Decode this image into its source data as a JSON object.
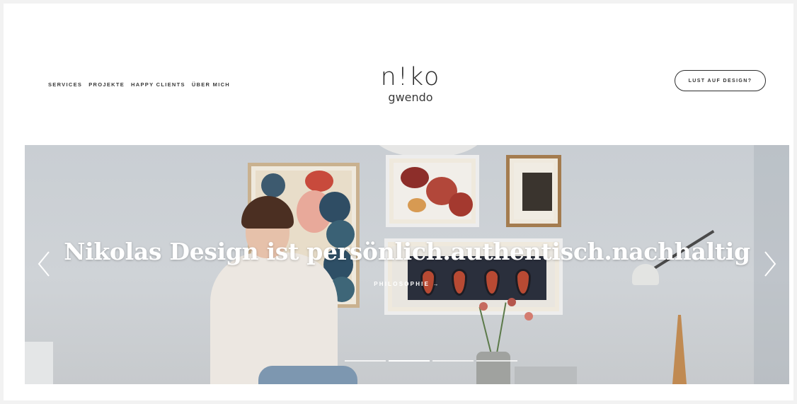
{
  "header": {
    "nav": [
      {
        "label": "SERVICES"
      },
      {
        "label": "PROJEKTE"
      },
      {
        "label": "HAPPY CLIENTS"
      },
      {
        "label": "ÜBER MICH"
      }
    ],
    "logo": {
      "main": "n!ko",
      "sub": "gwendo"
    },
    "cta_label": "LUST AUF DESIGN?"
  },
  "hero": {
    "headline": "Nikolas Design ist persönlich.authentisch.nachhaltig",
    "link_label": "PHILOSOPHIE →",
    "slides_count": 4,
    "active_slide": 1,
    "prev_icon": "chevron-left-icon",
    "next_icon": "chevron-right-icon"
  }
}
